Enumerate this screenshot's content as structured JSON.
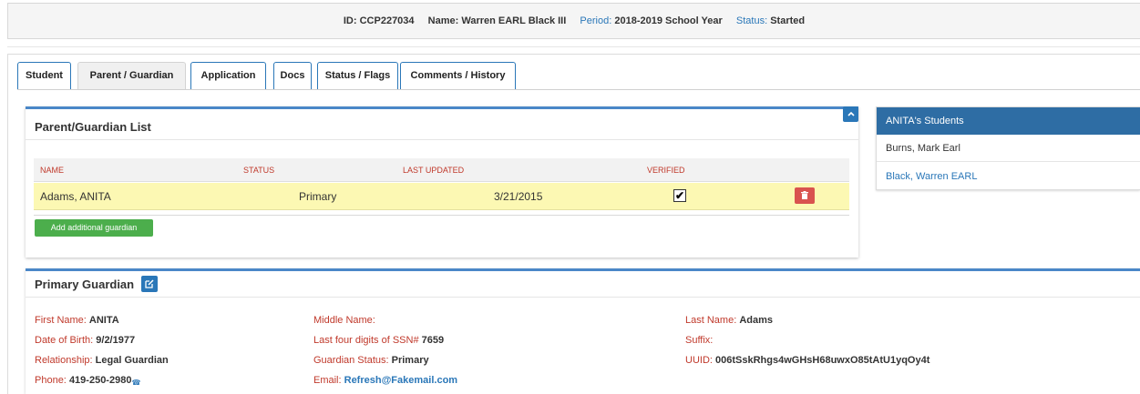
{
  "header": {
    "id_label": "ID:",
    "id_value": "CCP227034",
    "name_label": "Name:",
    "name_value": "Warren EARL Black III",
    "period_label": "Period:",
    "period_value": "2018-2019 School Year",
    "status_label": "Status:",
    "status_value": "Started"
  },
  "tabs": [
    {
      "label": "Student"
    },
    {
      "label": "Parent / Guardian"
    },
    {
      "label": "Application"
    },
    {
      "label": "Docs"
    },
    {
      "label": "Status / Flags"
    },
    {
      "label": "Comments / History"
    }
  ],
  "active_tab": "Parent / Guardian",
  "guardian_list": {
    "title": "Parent/Guardian List",
    "columns": [
      "NAME",
      "STATUS",
      "LAST UPDATED",
      "VERIFIED"
    ],
    "rows": [
      {
        "name": "Adams, ANITA",
        "status": "Primary",
        "last_updated": "3/21/2015",
        "verified": true
      }
    ],
    "add_button": "Add additional guardian",
    "collapse_icon": "chevron-up-icon",
    "delete_icon": "trash-icon"
  },
  "students_panel": {
    "title": "ANITA's Students",
    "items": [
      {
        "label": "Burns, Mark Earl",
        "link": false
      },
      {
        "label": "Black, Warren EARL",
        "link": true
      }
    ]
  },
  "primary_guardian": {
    "title": "Primary Guardian",
    "edit_icon": "edit-icon",
    "fields": {
      "first_name": {
        "label": "First Name:",
        "value": "ANITA"
      },
      "dob": {
        "label": "Date of Birth:",
        "value": "9/2/1977"
      },
      "relationship": {
        "label": "Relationship:",
        "value": "Legal Guardian"
      },
      "phone": {
        "label": "Phone:",
        "value": "419-250-2980"
      },
      "middle_name": {
        "label": "Middle Name:",
        "value": ""
      },
      "ssn": {
        "label": "Last four digits of SSN#",
        "value": "7659"
      },
      "guardian_status": {
        "label": "Guardian Status:",
        "value": "Primary"
      },
      "email": {
        "label": "Email:",
        "value": "Refresh@Fakemail.com"
      },
      "last_name": {
        "label": "Last Name:",
        "value": "Adams"
      },
      "suffix": {
        "label": "Suffix:",
        "value": ""
      },
      "uuid": {
        "label": "UUID:",
        "value": "006tSskRhgs4wGHsH68uwxO85tAtU1yqOy4t"
      }
    }
  },
  "colors": {
    "accent_blue": "#2a77b8",
    "header_blue": "#2e6da4",
    "label_red": "#c0392b",
    "row_highlight": "#fcf8b3",
    "delete_red": "#d9534f",
    "add_green": "#4cae4c"
  }
}
